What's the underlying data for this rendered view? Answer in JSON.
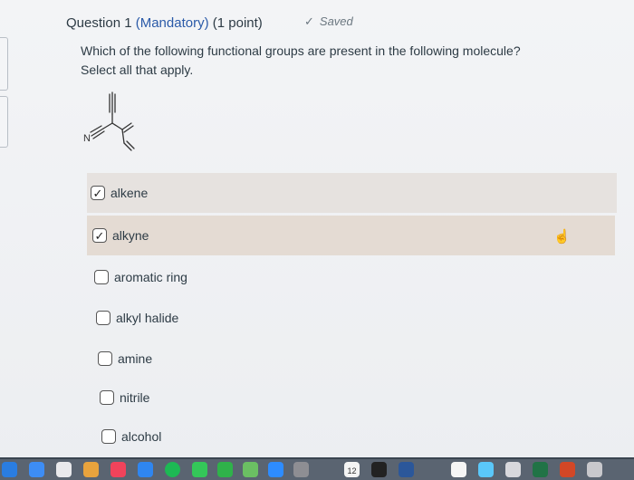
{
  "question": {
    "title": "Question 1",
    "mandatory": "(Mandatory)",
    "points": "(1 point)",
    "saved_label": "Saved",
    "saved_icon": "checkmark-icon",
    "line1": "Which of the following functional groups are present in the following molecule?",
    "line2": "Select all that apply."
  },
  "molecule": {
    "nitrogen_label": "N"
  },
  "options": [
    {
      "label": "alkene",
      "checked": true
    },
    {
      "label": "alkyne",
      "checked": true
    },
    {
      "label": "aromatic ring",
      "checked": false
    },
    {
      "label": "alkyl halide",
      "checked": false
    },
    {
      "label": "amine",
      "checked": false
    },
    {
      "label": "nitrile",
      "checked": false
    },
    {
      "label": "alcohol",
      "checked": false
    }
  ],
  "checkbox_checked_glyph": "✓",
  "colors": {
    "mandatory_text": "#2a5aa8",
    "selected_row_1": "#e6e2df",
    "selected_row_2": "#e4dbd3",
    "taskbar": "#5a6471"
  },
  "taskbar_icons": [
    "finder-icon",
    "mail-icon",
    "calendar-icon",
    "photos-icon",
    "music-icon",
    "app-store-icon",
    "spotify-icon",
    "messages-icon",
    "facetime-icon",
    "maps-icon",
    "zoom-icon",
    "settings-icon",
    "calendar-date-icon",
    "terminal-icon",
    "word-icon",
    "notes-icon",
    "browser-icon",
    "preview-icon",
    "excel-icon",
    "powerpoint-icon",
    "trash-icon"
  ],
  "taskbar_calendar_date": "12"
}
